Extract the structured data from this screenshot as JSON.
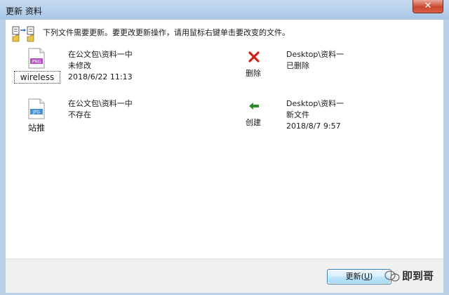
{
  "window": {
    "title": "更新 资料",
    "close_symbol": "✕"
  },
  "header": {
    "text": "下列文件需要更新。要更改更新操作，请用鼠标右键单击要改变的文件。"
  },
  "files": [
    {
      "icon_type": "png-file-icon",
      "badge": "PNG",
      "name": "wireless",
      "source_location": "在公文包\\资料一中",
      "source_status": "未修改",
      "source_date": "2018/6/22 11:13",
      "action": "删除",
      "action_icon": "red-x-icon",
      "dest_location": "Desktop\\资料一",
      "dest_status": "已删除",
      "dest_date": ""
    },
    {
      "icon_type": "jpg-file-icon",
      "badge": "JPG",
      "name": "站推",
      "source_location": "在公文包\\资料一中",
      "source_status": "不存在",
      "source_date": "",
      "action": "创建",
      "action_icon": "green-left-arrow-icon",
      "dest_location": "Desktop\\资料一",
      "dest_status": "新文件",
      "dest_date": "2018/8/7 9:57"
    }
  ],
  "footer": {
    "update_label": "更新",
    "update_hotkey": "U",
    "watermark": "即到哥"
  },
  "colors": {
    "window_frame": "#b9d1ea",
    "close_red": "#c9462c",
    "delete_red": "#d0201c",
    "create_green": "#2e8a2e",
    "png_badge": "#b94fc4",
    "jpg_badge": "#4a8fd0"
  }
}
